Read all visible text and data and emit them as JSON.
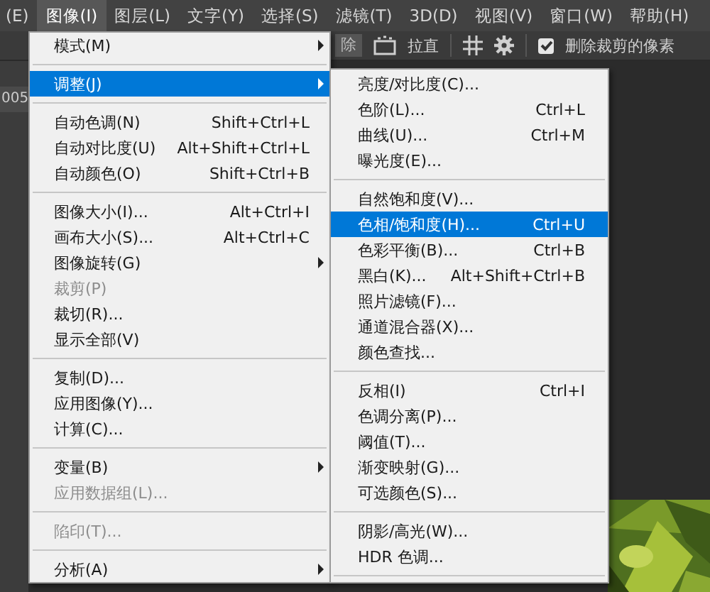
{
  "menubar": [
    {
      "label": "(E)",
      "selected": false
    },
    {
      "label": "图像(I)",
      "selected": true
    },
    {
      "label": "图层(L)",
      "selected": false
    },
    {
      "label": "文字(Y)",
      "selected": false
    },
    {
      "label": "选择(S)",
      "selected": false
    },
    {
      "label": "滤镜(T)",
      "selected": false
    },
    {
      "label": "3D(D)",
      "selected": false
    },
    {
      "label": "视图(V)",
      "selected": false
    },
    {
      "label": "窗口(W)",
      "selected": false
    },
    {
      "label": "帮助(H)",
      "selected": false
    }
  ],
  "options_bar": {
    "field_text": "除",
    "straighten_label": "拉直",
    "delete_cropped": {
      "label": "删除裁剪的像素",
      "checked": true
    }
  },
  "document_tab": "005",
  "image_menu": [
    {
      "kind": "item",
      "label": "模式(M)",
      "submenu": true,
      "disabled": false,
      "selected": false
    },
    {
      "kind": "separator"
    },
    {
      "kind": "item",
      "label": "调整(J)",
      "submenu": true,
      "disabled": false,
      "selected": true
    },
    {
      "kind": "separator"
    },
    {
      "kind": "item",
      "label": "自动色调(N)",
      "shortcut": "Shift+Ctrl+L",
      "submenu": false,
      "disabled": false,
      "selected": false
    },
    {
      "kind": "item",
      "label": "自动对比度(U)",
      "shortcut": "Alt+Shift+Ctrl+L",
      "submenu": false,
      "disabled": false,
      "selected": false
    },
    {
      "kind": "item",
      "label": "自动颜色(O)",
      "shortcut": "Shift+Ctrl+B",
      "submenu": false,
      "disabled": false,
      "selected": false
    },
    {
      "kind": "separator"
    },
    {
      "kind": "item",
      "label": "图像大小(I)...",
      "shortcut": "Alt+Ctrl+I",
      "submenu": false,
      "disabled": false,
      "selected": false
    },
    {
      "kind": "item",
      "label": "画布大小(S)...",
      "shortcut": "Alt+Ctrl+C",
      "submenu": false,
      "disabled": false,
      "selected": false
    },
    {
      "kind": "item",
      "label": "图像旋转(G)",
      "submenu": true,
      "disabled": false,
      "selected": false
    },
    {
      "kind": "item",
      "label": "裁剪(P)",
      "submenu": false,
      "disabled": true,
      "selected": false
    },
    {
      "kind": "item",
      "label": "裁切(R)...",
      "submenu": false,
      "disabled": false,
      "selected": false
    },
    {
      "kind": "item",
      "label": "显示全部(V)",
      "submenu": false,
      "disabled": false,
      "selected": false
    },
    {
      "kind": "separator"
    },
    {
      "kind": "item",
      "label": "复制(D)...",
      "submenu": false,
      "disabled": false,
      "selected": false
    },
    {
      "kind": "item",
      "label": "应用图像(Y)...",
      "submenu": false,
      "disabled": false,
      "selected": false
    },
    {
      "kind": "item",
      "label": "计算(C)...",
      "submenu": false,
      "disabled": false,
      "selected": false
    },
    {
      "kind": "separator"
    },
    {
      "kind": "item",
      "label": "变量(B)",
      "submenu": true,
      "disabled": false,
      "selected": false
    },
    {
      "kind": "item",
      "label": "应用数据组(L)...",
      "submenu": false,
      "disabled": true,
      "selected": false
    },
    {
      "kind": "separator"
    },
    {
      "kind": "item",
      "label": "陷印(T)...",
      "submenu": false,
      "disabled": true,
      "selected": false
    },
    {
      "kind": "separator"
    },
    {
      "kind": "item",
      "label": "分析(A)",
      "submenu": true,
      "disabled": false,
      "selected": false
    }
  ],
  "adjustments_menu": [
    {
      "kind": "item",
      "label": "亮度/对比度(C)...",
      "selected": false
    },
    {
      "kind": "item",
      "label": "色阶(L)...",
      "shortcut": "Ctrl+L",
      "selected": false
    },
    {
      "kind": "item",
      "label": "曲线(U)...",
      "shortcut": "Ctrl+M",
      "selected": false
    },
    {
      "kind": "item",
      "label": "曝光度(E)...",
      "selected": false
    },
    {
      "kind": "separator"
    },
    {
      "kind": "item",
      "label": "自然饱和度(V)...",
      "selected": false
    },
    {
      "kind": "item",
      "label": "色相/饱和度(H)...",
      "shortcut": "Ctrl+U",
      "selected": true
    },
    {
      "kind": "item",
      "label": "色彩平衡(B)...",
      "shortcut": "Ctrl+B",
      "selected": false
    },
    {
      "kind": "item",
      "label": "黑白(K)...",
      "shortcut": "Alt+Shift+Ctrl+B",
      "selected": false
    },
    {
      "kind": "item",
      "label": "照片滤镜(F)...",
      "selected": false
    },
    {
      "kind": "item",
      "label": "通道混合器(X)...",
      "selected": false
    },
    {
      "kind": "item",
      "label": "颜色查找...",
      "selected": false
    },
    {
      "kind": "separator"
    },
    {
      "kind": "item",
      "label": "反相(I)",
      "shortcut": "Ctrl+I",
      "selected": false
    },
    {
      "kind": "item",
      "label": "色调分离(P)...",
      "selected": false
    },
    {
      "kind": "item",
      "label": "阈值(T)...",
      "selected": false
    },
    {
      "kind": "item",
      "label": "渐变映射(G)...",
      "selected": false
    },
    {
      "kind": "item",
      "label": "可选颜色(S)...",
      "selected": false
    },
    {
      "kind": "separator"
    },
    {
      "kind": "item",
      "label": "阴影/高光(W)...",
      "selected": false
    },
    {
      "kind": "item",
      "label": "HDR 色调...",
      "selected": false
    },
    {
      "kind": "separator"
    }
  ]
}
